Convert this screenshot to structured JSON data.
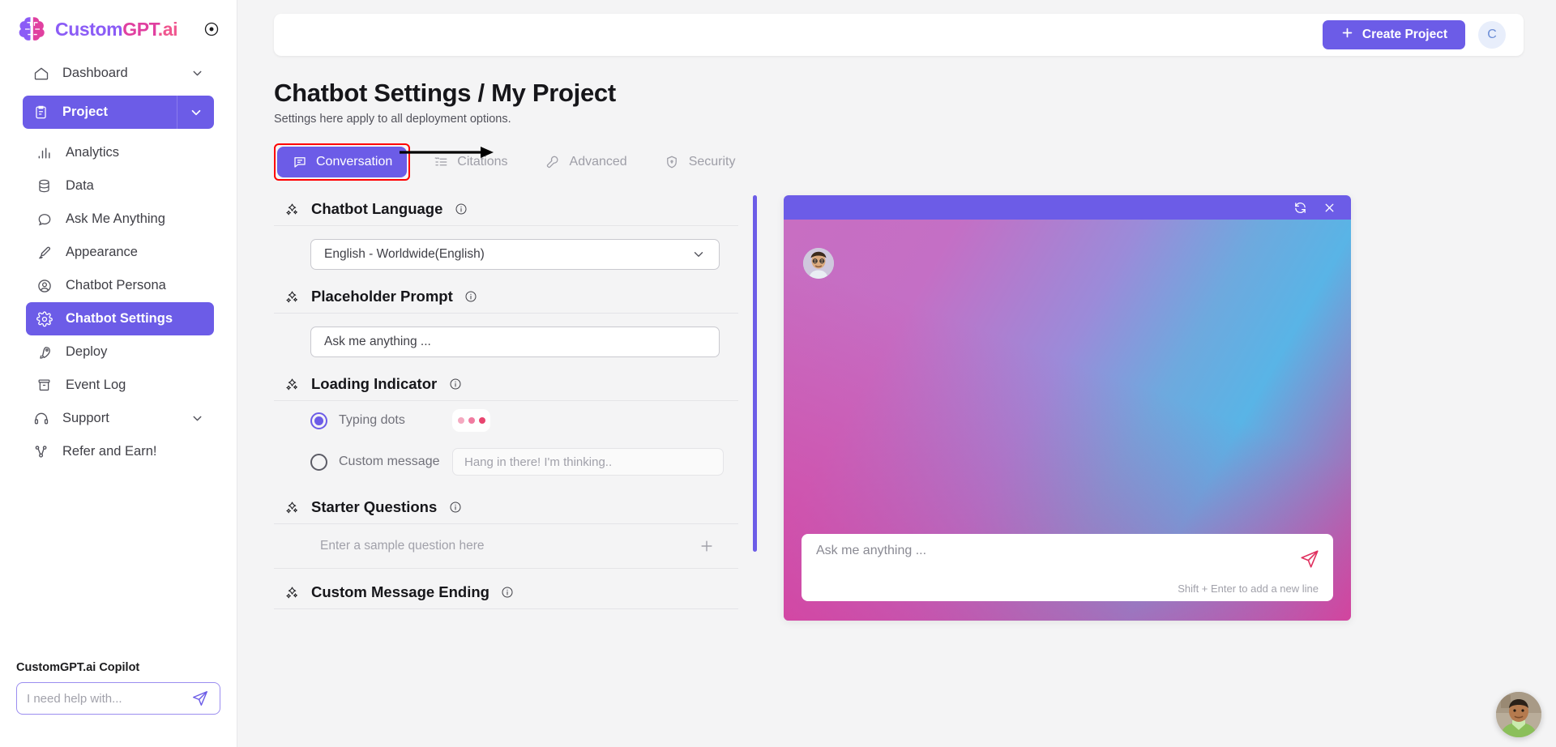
{
  "brand": {
    "name_part1": "Custom",
    "name_part2": "GPT",
    "name_part3": ".ai",
    "logo_icon": "brain-icon",
    "collapse_icon": "collapse-circle-icon"
  },
  "sidebar": {
    "items": [
      {
        "label": "Dashboard",
        "icon": "home-icon",
        "chevron": true,
        "active": false
      },
      {
        "label": "Project",
        "icon": "clipboard-icon",
        "chevron": true,
        "active": true
      },
      {
        "label": "Analytics",
        "icon": "bar-chart-icon",
        "chevron": false,
        "active": false
      },
      {
        "label": "Data",
        "icon": "database-icon",
        "chevron": false,
        "active": false
      },
      {
        "label": "Ask Me Anything",
        "icon": "chat-bubble-icon",
        "chevron": false,
        "active": false
      },
      {
        "label": "Appearance",
        "icon": "paintbrush-icon",
        "chevron": false,
        "active": false
      },
      {
        "label": "Chatbot Persona",
        "icon": "user-circle-icon",
        "chevron": false,
        "active": false
      },
      {
        "label": "Chatbot Settings",
        "icon": "gear-icon",
        "chevron": false,
        "active": true
      },
      {
        "label": "Deploy",
        "icon": "rocket-icon",
        "chevron": false,
        "active": false
      },
      {
        "label": "Event Log",
        "icon": "archive-icon",
        "chevron": false,
        "active": false
      },
      {
        "label": "Support",
        "icon": "headset-icon",
        "chevron": true,
        "active": false
      },
      {
        "label": "Refer and Earn!",
        "icon": "share-nodes-icon",
        "chevron": false,
        "active": false
      }
    ],
    "copilot": {
      "title": "CustomGPT.ai Copilot",
      "placeholder": "I need help with...",
      "value": "",
      "send_icon": "paper-plane-icon"
    }
  },
  "topbar": {
    "create_label": "Create Project",
    "create_icon": "plus-icon",
    "avatar_initial": "C"
  },
  "page": {
    "title": "Chatbot Settings / My Project",
    "subtitle": "Settings here apply to all deployment options."
  },
  "tabs": [
    {
      "label": "Conversation",
      "icon": "conversation-icon",
      "active": true
    },
    {
      "label": "Citations",
      "icon": "citations-icon",
      "active": false
    },
    {
      "label": "Advanced",
      "icon": "wrench-icon",
      "active": false
    },
    {
      "label": "Security",
      "icon": "shield-icon",
      "active": false
    }
  ],
  "settings": {
    "chatbot_language": {
      "title": "Chatbot Language",
      "info_icon": "info-icon",
      "sparkle_icon": "sparkle-icon",
      "selected": "English - Worldwide(English)",
      "chevron_icon": "chevron-down-icon"
    },
    "placeholder_prompt": {
      "title": "Placeholder Prompt",
      "info_icon": "info-icon",
      "sparkle_icon": "sparkle-icon",
      "value": "Ask me anything ...",
      "placeholder": "Ask me anything ..."
    },
    "loading_indicator": {
      "title": "Loading Indicator",
      "info_icon": "info-icon",
      "sparkle_icon": "sparkle-icon",
      "options": [
        {
          "label": "Typing dots",
          "selected": true
        },
        {
          "label": "Custom message",
          "selected": false
        }
      ],
      "custom_message_placeholder": "Hang in there! I'm thinking..",
      "custom_message_value": "",
      "dots_colors": [
        "#f4a9c0",
        "#f07ba0",
        "#e8456f"
      ]
    },
    "starter_questions": {
      "title": "Starter Questions",
      "info_icon": "info-icon",
      "sparkle_icon": "sparkle-icon",
      "placeholder": "Enter a sample question here",
      "value": "",
      "add_icon": "plus-icon"
    },
    "custom_message_ending": {
      "title": "Custom Message Ending",
      "info_icon": "info-icon",
      "sparkle_icon": "sparkle-icon",
      "value": "",
      "placeholder": ""
    }
  },
  "preview": {
    "refresh_icon": "refresh-icon",
    "close_icon": "close-icon",
    "avatar_icon": "bot-avatar-icon",
    "input_placeholder": "Ask me anything ...",
    "hint": "Shift + Enter to add a new line",
    "send_icon": "paper-plane-icon",
    "header_color": "#6c5ce7"
  },
  "float_bubble": {
    "icon": "support-agent-avatar-icon"
  },
  "annotation": {
    "arrow_icon": "pointer-arrow-icon",
    "highlight_color": "#ff0000"
  },
  "theme": {
    "accent": "#6c5ce7",
    "bg": "#f4f4f5",
    "panel": "#ffffff"
  }
}
